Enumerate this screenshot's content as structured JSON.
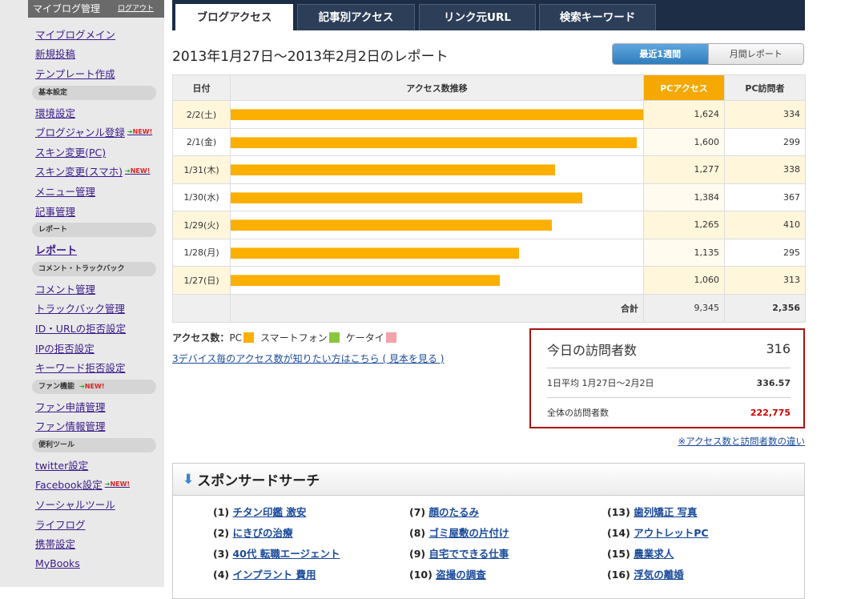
{
  "sidebar": {
    "title": "マイブログ管理",
    "logout": "ログアウト",
    "group_main": [
      "マイブログメイン",
      "新規投稿",
      "テンプレート作成"
    ],
    "basic_head": "基本設定",
    "basic": [
      "環境設定",
      "ブログジャンル登録",
      "スキン変更(PC)",
      "スキン変更(スマホ)",
      "メニュー管理",
      "記事管理"
    ],
    "report_head": "レポート",
    "report": "レポート",
    "comment_head": "コメント・トラックバック",
    "comment": [
      "コメント管理",
      "トラックバック管理",
      "ID・URLの拒否設定",
      "IPの拒否設定",
      "キーワード拒否設定"
    ],
    "fan_head": "ファン機能",
    "fan": [
      "ファン申請管理",
      "ファン情報管理"
    ],
    "tools_head": "便利ツール",
    "tools": [
      "twitter設定",
      "Facebook設定",
      "ソーシャルツール",
      "ライフログ",
      "携帯設定",
      "MyBooks"
    ],
    "new_label": "NEW!"
  },
  "tabs": [
    "ブログアクセス",
    "記事別アクセス",
    "リンク元URL",
    "検索キーワード"
  ],
  "report_title": "2013年1月27日〜2013年2月2日のレポート",
  "period": {
    "weekly": "最近1週間",
    "monthly": "月間レポート"
  },
  "table": {
    "headers": {
      "date": "日付",
      "trend": "アクセス数推移",
      "pc": "PCアクセス",
      "visitors": "PC訪問者"
    },
    "rows": [
      {
        "date": "2/2(土)",
        "pc": "1,624",
        "pc_value": 1624,
        "visitors": "334"
      },
      {
        "date": "2/1(金)",
        "pc": "1,600",
        "pc_value": 1600,
        "visitors": "299"
      },
      {
        "date": "1/31(木)",
        "pc": "1,277",
        "pc_value": 1277,
        "visitors": "338"
      },
      {
        "date": "1/30(水)",
        "pc": "1,384",
        "pc_value": 1384,
        "visitors": "367"
      },
      {
        "date": "1/29(火)",
        "pc": "1,265",
        "pc_value": 1265,
        "visitors": "410"
      },
      {
        "date": "1/28(月)",
        "pc": "1,135",
        "pc_value": 1135,
        "visitors": "295"
      },
      {
        "date": "1/27(日)",
        "pc": "1,060",
        "pc_value": 1060,
        "visitors": "313"
      }
    ],
    "total_label": "合計",
    "total_pc": "9,345",
    "total_visitors": "2,356"
  },
  "legend": {
    "label": "アクセス数：",
    "pc": "PC",
    "pc_color": "#fbaf00",
    "smartphone": "スマートフォン",
    "smartphone_color": "#8cc63f",
    "mobile": "ケータイ",
    "mobile_color": "#f4a3a8"
  },
  "device_link": "3デバイス毎のアクセス数が知りたい方はこちら ( 見本を見る )",
  "visitors": {
    "today_label": "今日の訪問者数",
    "today_value": "316",
    "avg_label": "1日平均 1月27日〜2月2日",
    "avg_value": "336.57",
    "total_label": "全体の訪問者数",
    "total_value": "222,775"
  },
  "diff_link": "※アクセス数と訪問者数の違い",
  "sponsored": {
    "title": "スポンサードサーチ",
    "items": [
      {
        "n": "(1)",
        "t": "チタン印鑑 激安"
      },
      {
        "n": "(2)",
        "t": "にきびの治療"
      },
      {
        "n": "(3)",
        "t": "40代 転職エージェント"
      },
      {
        "n": "(4)",
        "t": "インプラント 費用"
      },
      {
        "n": "(7)",
        "t": "顔のたるみ"
      },
      {
        "n": "(8)",
        "t": "ゴミ屋敷の片付け"
      },
      {
        "n": "(9)",
        "t": "自宅でできる仕事"
      },
      {
        "n": "(10)",
        "t": "盗撮の調査"
      },
      {
        "n": "(13)",
        "t": "歯列矯正 写真"
      },
      {
        "n": "(14)",
        "t": "アウトレットPC"
      },
      {
        "n": "(15)",
        "t": "農業求人"
      },
      {
        "n": "(16)",
        "t": "浮気の離婚"
      }
    ]
  }
}
